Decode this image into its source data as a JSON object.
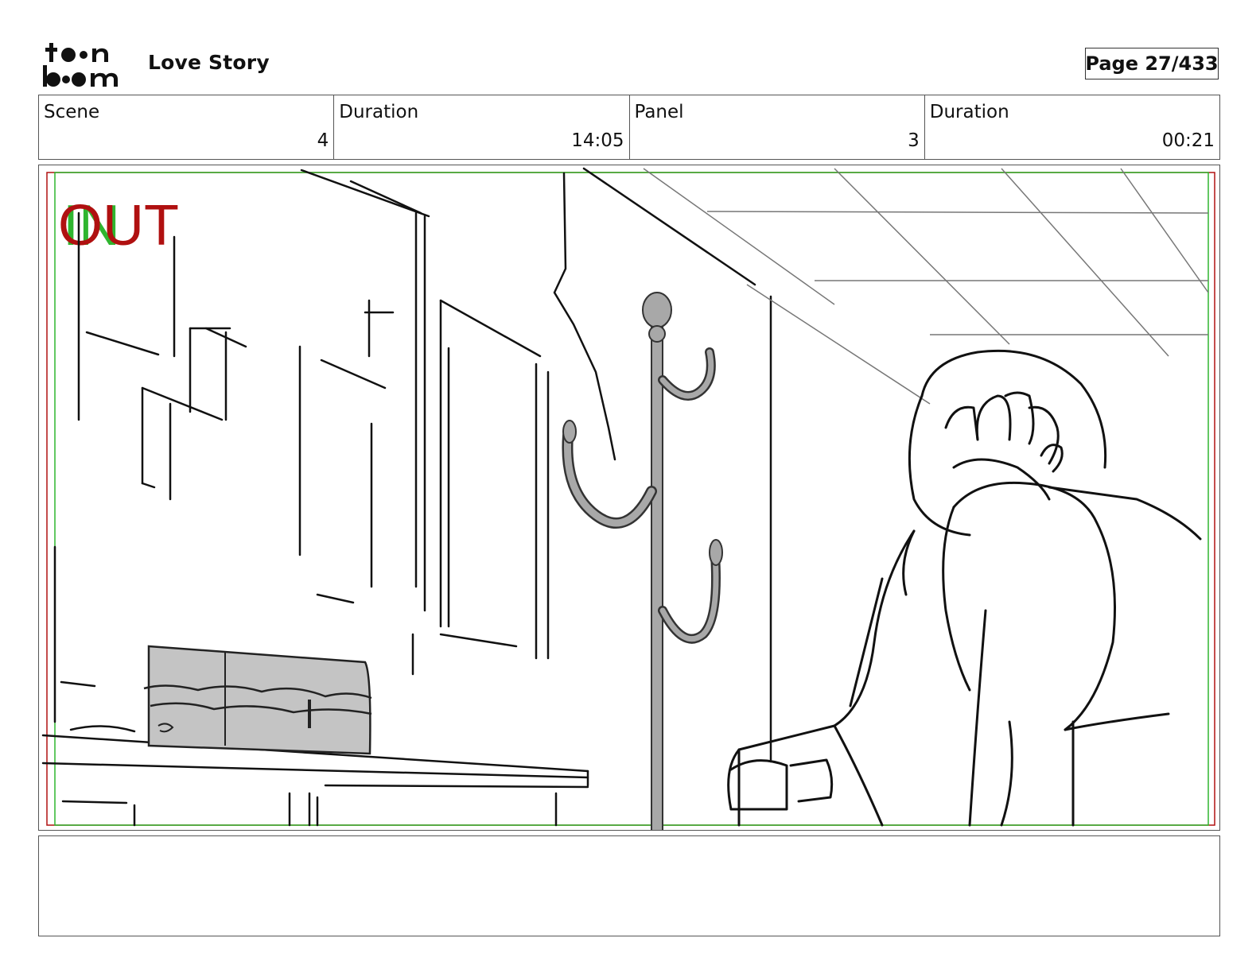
{
  "header": {
    "logo_text_top": "toon",
    "logo_text_bottom": "boom",
    "project_title": "Love Story",
    "page_label": "Page",
    "page_number": "27/433"
  },
  "info": {
    "scene_label": "Scene",
    "scene_value": "4",
    "scene_duration_label": "Duration",
    "scene_duration_value": "14:05",
    "panel_label": "Panel",
    "panel_value": "3",
    "panel_duration_label": "Duration",
    "panel_duration_value": "00:21"
  },
  "panel": {
    "in_marker": "IN",
    "out_marker": "OUT",
    "in_color": "#2fb52f",
    "out_color": "#b01010"
  },
  "notes": {
    "text": ""
  }
}
